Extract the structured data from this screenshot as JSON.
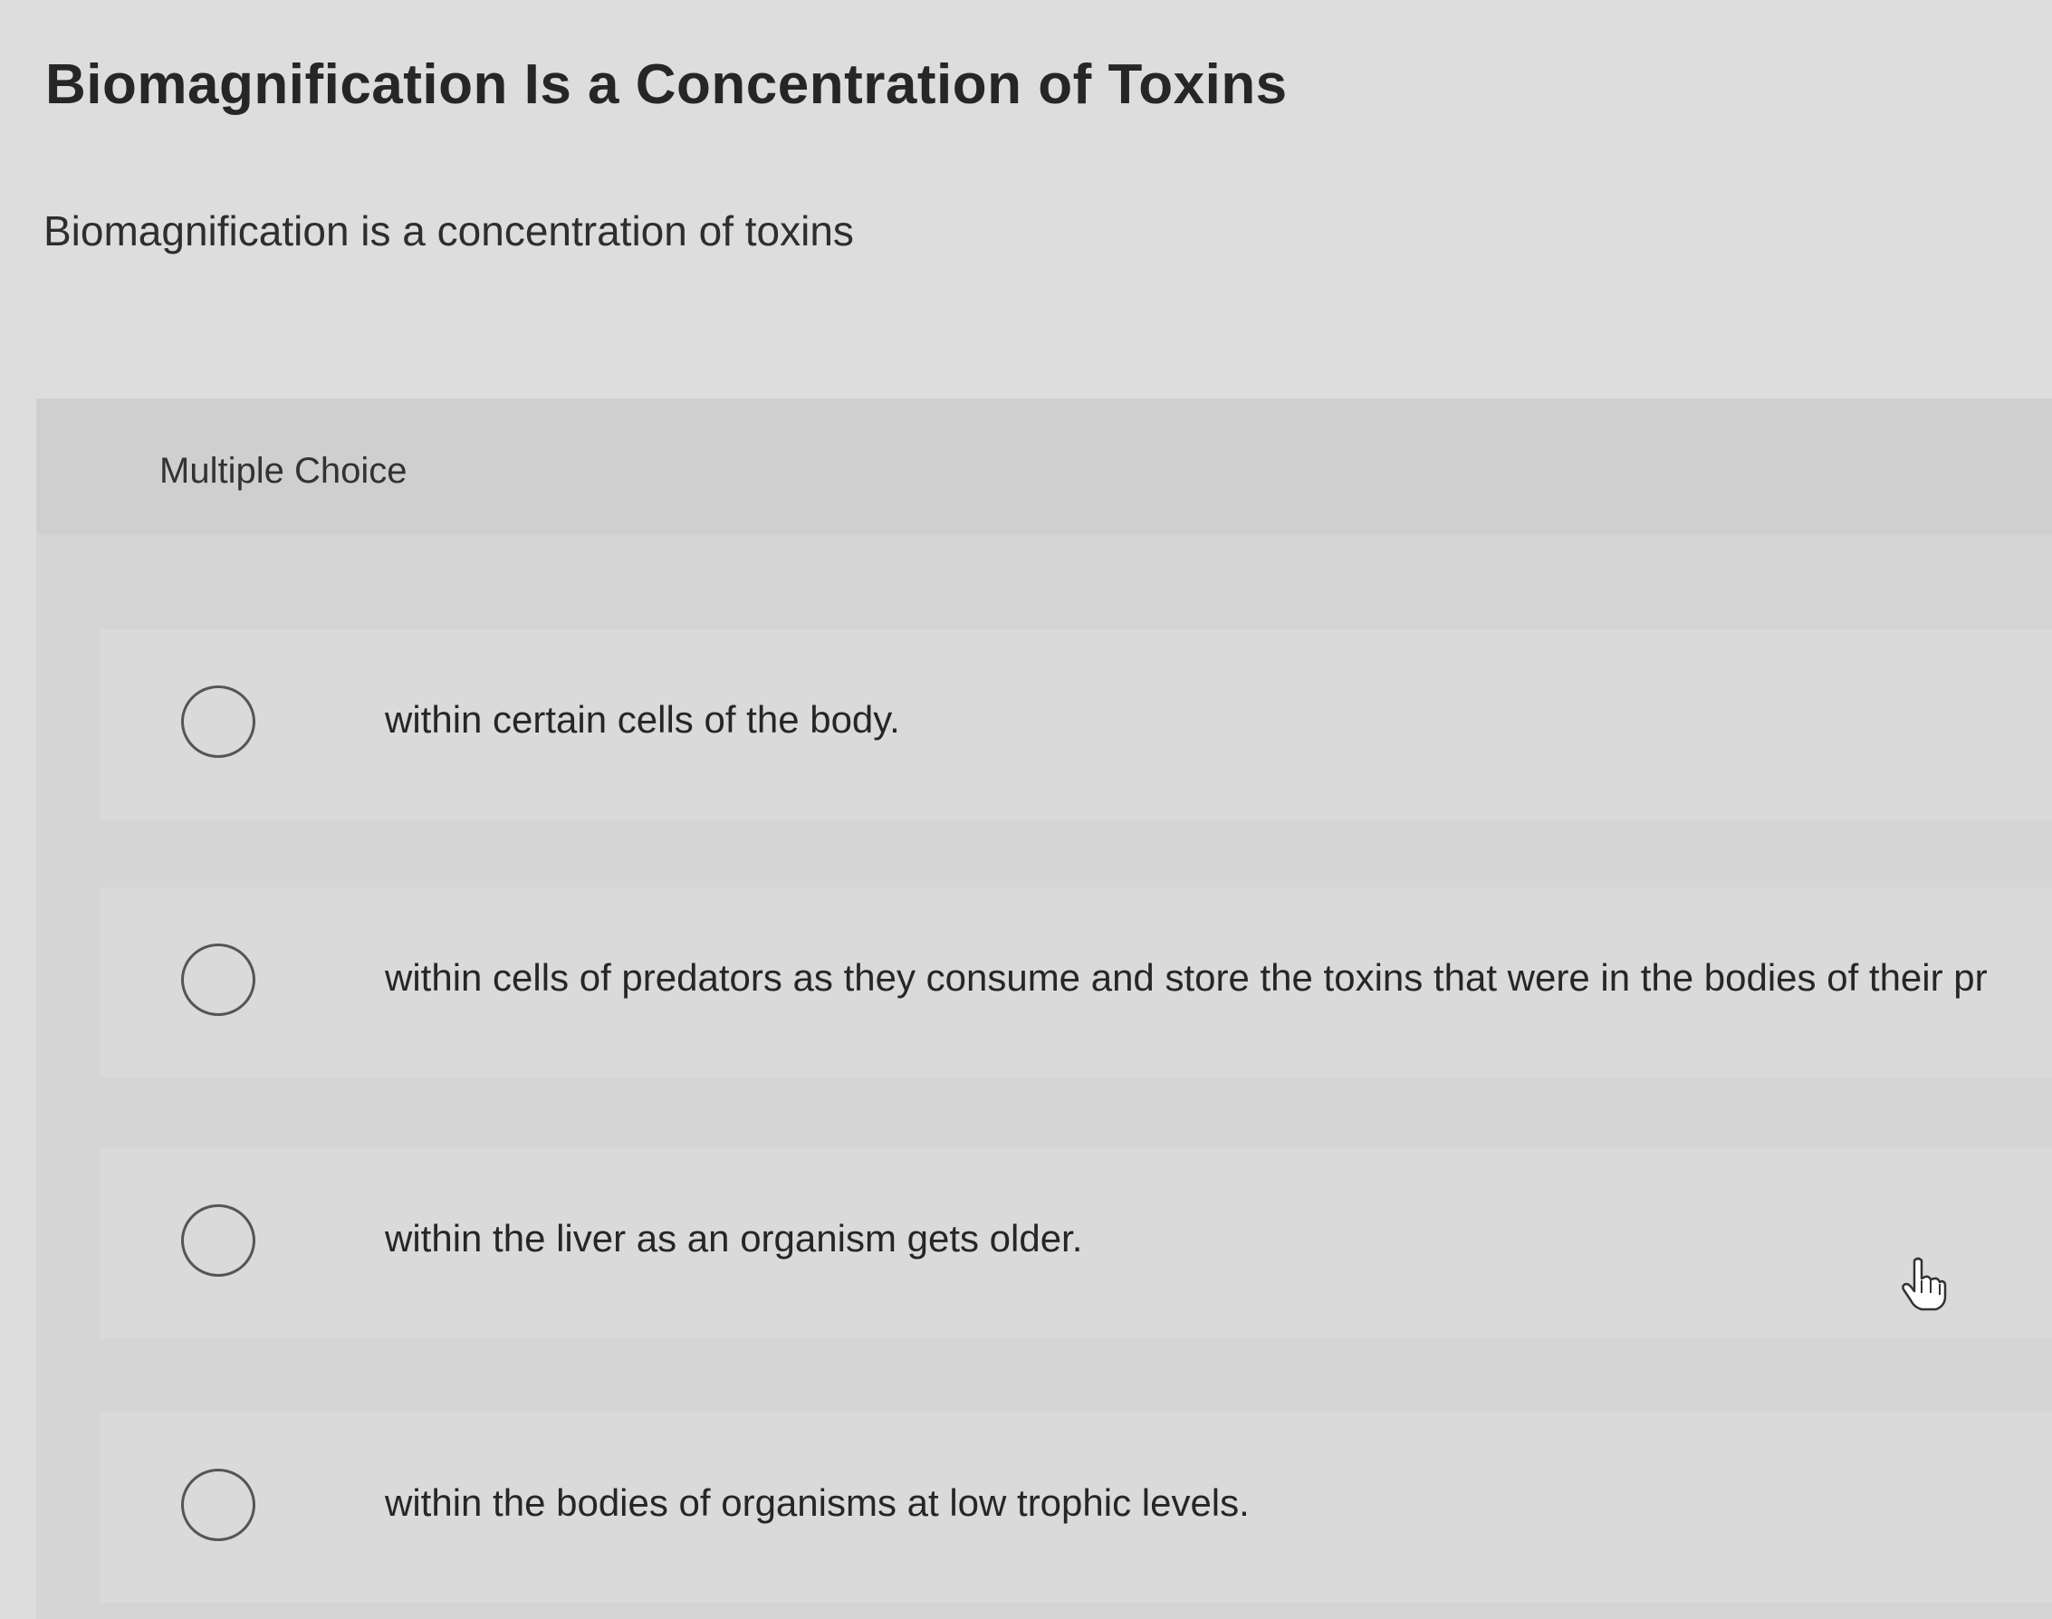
{
  "page": {
    "title": "Biomagnification Is a Concentration of Toxins"
  },
  "question": {
    "prompt": "Biomagnification is a concentration of toxins",
    "type_label": "Multiple Choice",
    "options": [
      {
        "label": "within certain cells of the body.",
        "selected": false
      },
      {
        "label": "within cells of predators as they consume and store the toxins that were in the bodies of their pr",
        "selected": false
      },
      {
        "label": "within the liver as an organism gets older.",
        "selected": false
      },
      {
        "label": "within the bodies of organisms at low trophic levels.",
        "selected": false
      }
    ]
  },
  "icons": {
    "radio": "radio-unselected-icon",
    "cursor": "hand-pointer-icon"
  },
  "colors": {
    "background": "#dddddd",
    "panel": "#d5d5d5",
    "text": "#262626"
  }
}
